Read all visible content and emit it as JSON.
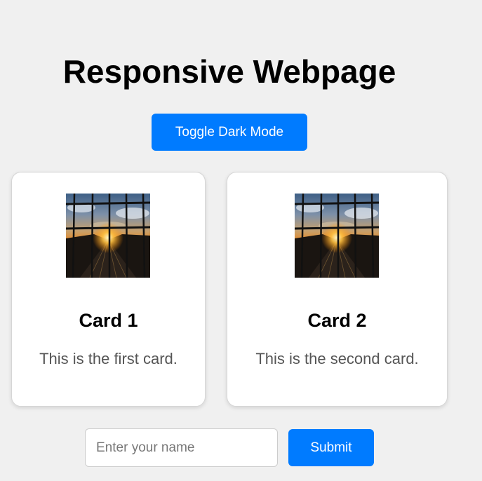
{
  "page": {
    "title": "Responsive Webpage",
    "background_color": "#f0f0f0"
  },
  "toggle_button": {
    "label": "Toggle Dark Mode",
    "color": "#007bff"
  },
  "cards": [
    {
      "title": "Card 1",
      "text": "This is the first card.",
      "image": "sunset-highway-photo"
    },
    {
      "title": "Card 2",
      "text": "This is the second card.",
      "image": "sunset-highway-photo"
    }
  ],
  "form": {
    "name_placeholder": "Enter your name",
    "name_value": "",
    "submit_label": "Submit",
    "submit_color": "#007bff"
  }
}
